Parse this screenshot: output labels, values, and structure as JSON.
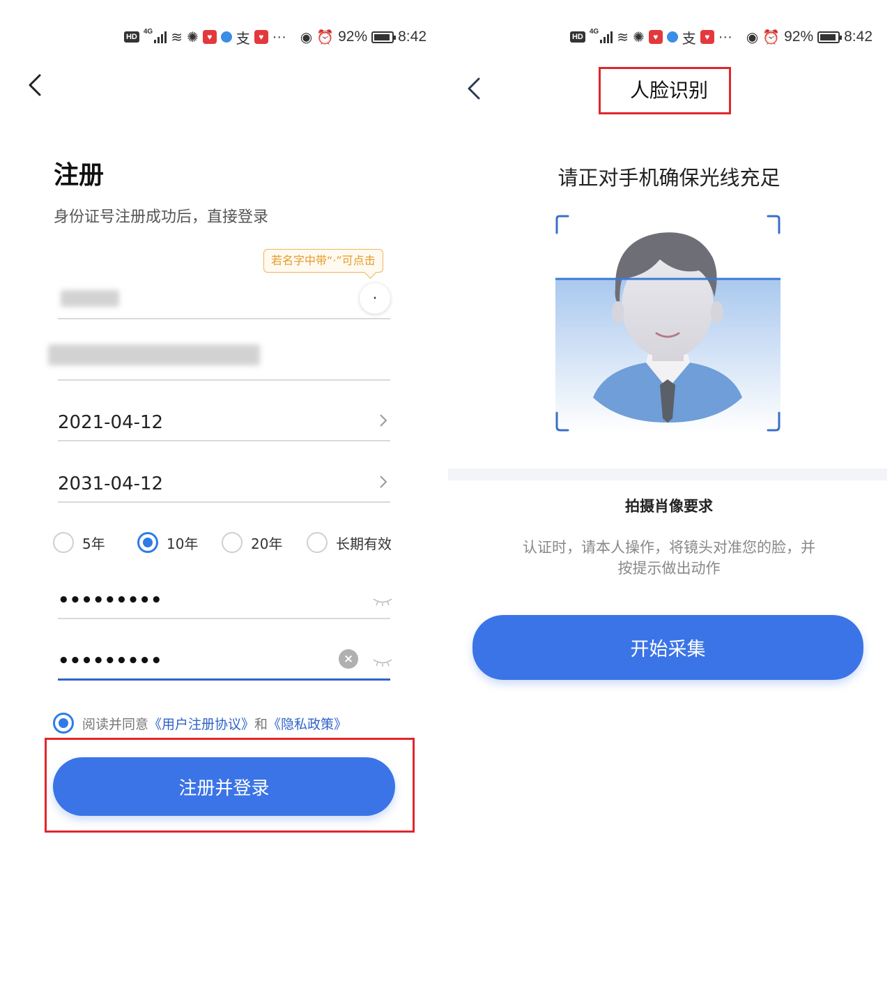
{
  "status_bar": {
    "battery": "92%",
    "time": "8:42",
    "hd": "HD",
    "network": "4G",
    "more": "···"
  },
  "register": {
    "title": "注册",
    "subtitle": "身份证号注册成功后，直接登录",
    "name_tooltip": "若名字中带“·”可点击",
    "dot_button": "·",
    "start_date": "2021-04-12",
    "end_date": "2031-04-12",
    "validity_options": [
      {
        "label": "5年",
        "selected": false
      },
      {
        "label": "10年",
        "selected": true
      },
      {
        "label": "20年",
        "selected": false
      },
      {
        "label": "长期有效",
        "selected": false
      }
    ],
    "password": "•••••••••",
    "confirm_password": "•••••••••",
    "agree_prefix": "阅读并同意",
    "agree_link1": "《用户注册协议》",
    "agree_mid": "和",
    "agree_link2": "《隐私政策》",
    "submit_label": "注册并登录"
  },
  "face": {
    "title": "人脸识别",
    "instruction": "请正对手机确保光线充足",
    "requirements_title": "拍摄肖像要求",
    "requirements_desc": "认证时，请本人操作，将镜头对准您的脸，并按提示做出动作",
    "start_label": "开始采集"
  },
  "colors": {
    "primary": "#3b74e6",
    "highlight": "#e0262b",
    "tooltip": "#e59a2a",
    "link": "#2f63c9"
  }
}
